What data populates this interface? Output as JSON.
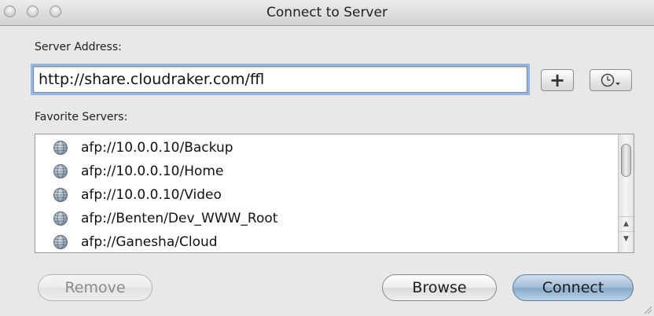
{
  "window": {
    "title": "Connect to Server"
  },
  "server": {
    "label": "Server Address:",
    "value": "http://share.cloudraker.com/ffl"
  },
  "buttons": {
    "add_label": "+",
    "remove_label": "Remove",
    "browse_label": "Browse",
    "connect_label": "Connect"
  },
  "favorites": {
    "label": "Favorite Servers:",
    "items": [
      "afp://10.0.0.10/Backup",
      "afp://10.0.0.10/Home",
      "afp://10.0.0.10/Video",
      "afp://Benten/Dev_WWW_Root",
      "afp://Ganesha/Cloud"
    ]
  },
  "icons": {
    "favorite_item": "globe-icon",
    "recent": "clock-icon",
    "add": "plus-icon"
  },
  "colors": {
    "focus_ring": "#8fb6e8",
    "connect_accent": "#9fbcd6"
  }
}
